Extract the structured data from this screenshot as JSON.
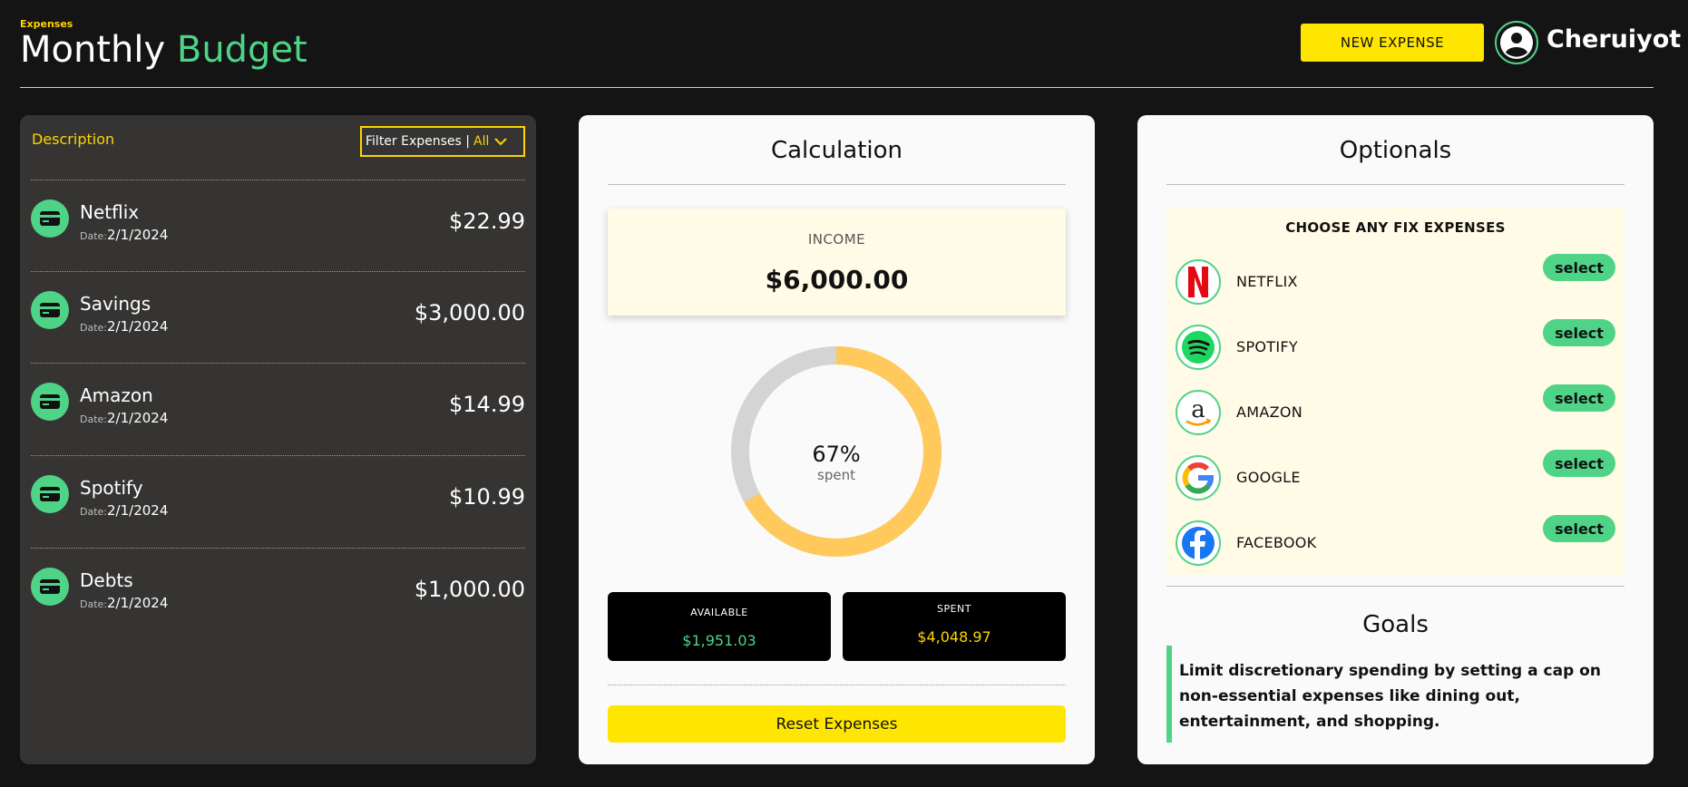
{
  "header": {
    "brand_small": "Expenses",
    "title_word1": "Monthly",
    "title_word2": "Budget",
    "new_expense_label": "NEW EXPENSE",
    "username": "Cheruiyot"
  },
  "expenses_panel": {
    "title": "Description",
    "filter_label": "Filter Expenses |",
    "filter_value": "All",
    "date_label": "Date:",
    "items": [
      {
        "name": "Netflix",
        "date": "2/1/2024",
        "amount": "$22.99"
      },
      {
        "name": "Savings",
        "date": "2/1/2024",
        "amount": "$3,000.00"
      },
      {
        "name": "Amazon",
        "date": "2/1/2024",
        "amount": "$14.99"
      },
      {
        "name": "Spotify",
        "date": "2/1/2024",
        "amount": "$10.99"
      },
      {
        "name": "Debts",
        "date": "2/1/2024",
        "amount": "$1,000.00"
      }
    ]
  },
  "calculation": {
    "title": "Calculation",
    "income_label": "INCOME",
    "income_value": "$6,000.00",
    "spent_percent": 67,
    "spent_percent_text": "67%",
    "spent_caption": "spent",
    "available_label": "AVAILABLE",
    "available_value": "$1,951.03",
    "spent_label": "SPENT",
    "spent_value": "$4,048.97",
    "reset_label": "Reset Expenses"
  },
  "optionals": {
    "title": "Optionals",
    "heading": "CHOOSE ANY FIX EXPENSES",
    "select_label": "select",
    "items": [
      {
        "name": "NETFLIX",
        "icon": "netflix-logo-icon"
      },
      {
        "name": "SPOTIFY",
        "icon": "spotify-logo-icon"
      },
      {
        "name": "AMAZON",
        "icon": "amazon-logo-icon"
      },
      {
        "name": "GOOGLE",
        "icon": "google-logo-icon"
      },
      {
        "name": "FACEBOOK",
        "icon": "facebook-logo-icon"
      }
    ]
  },
  "goals": {
    "title": "Goals",
    "text": "Limit discretionary spending by setting a cap on non-essential expenses like dining out, entertainment, and shopping."
  },
  "colors": {
    "background": "#141414",
    "accent_yellow": "#ffe600",
    "accent_green": "#4fd387",
    "donut_spent": "#ffc95c",
    "donut_remaining": "#d4d4d4"
  }
}
